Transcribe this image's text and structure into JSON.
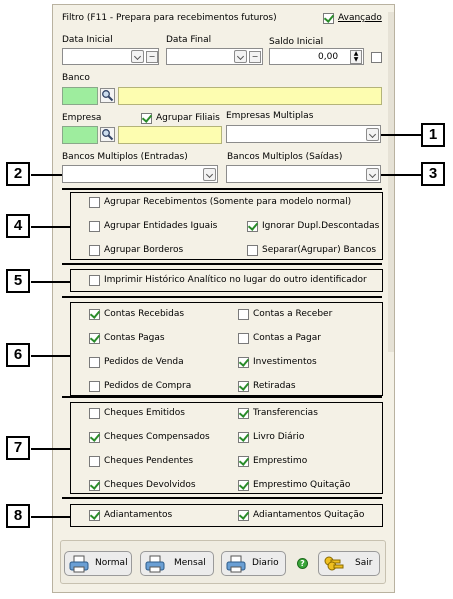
{
  "filter": {
    "title": "Filtro (F11 - Prepara para recebimentos futuros)",
    "advanced_label": "Avançado",
    "advanced_checked": true
  },
  "fields": {
    "data_inicial_label": "Data Inicial",
    "data_final_label": "Data Final",
    "saldo_inicial_label": "Saldo Inicial",
    "saldo_inicial_value": "0,00",
    "banco_label": "Banco",
    "empresa_label": "Empresa",
    "agrupar_filiais_label": "Agrupar Filiais",
    "agrupar_filiais_checked": true,
    "empresas_multiplas_label": "Empresas Multiplas",
    "bancos_multiplos_entradas_label": "Bancos Multiplos (Entradas)",
    "bancos_multiplos_saidas_label": "Bancos Multiplos (Saídas)"
  },
  "group4": {
    "agrupar_recebimentos": {
      "label": "Agrupar Recebimentos (Somente para modelo normal)",
      "checked": false
    },
    "agrupar_entidades": {
      "label": "Agrupar Entidades Iguais",
      "checked": false
    },
    "ignorar_dupl": {
      "label": "Ignorar Dupl.Descontadas",
      "checked": true
    },
    "agrupar_borderos": {
      "label": "Agrupar Borderos",
      "checked": false
    },
    "separar_bancos": {
      "label": "Separar(Agrupar) Bancos",
      "checked": false
    }
  },
  "group5": {
    "imprimir_historico": {
      "label": "Imprimir Histórico Analítico no lugar do outro identificador",
      "checked": false
    }
  },
  "group6": {
    "contas_recebidas": {
      "label": "Contas Recebidas",
      "checked": true
    },
    "contas_receber": {
      "label": "Contas a Receber",
      "checked": false
    },
    "contas_pagas": {
      "label": "Contas Pagas",
      "checked": true
    },
    "contas_pagar": {
      "label": "Contas a Pagar",
      "checked": false
    },
    "pedidos_venda": {
      "label": "Pedidos de Venda",
      "checked": false
    },
    "investimentos": {
      "label": "Investimentos",
      "checked": true
    },
    "pedidos_compra": {
      "label": "Pedidos de Compra",
      "checked": false
    },
    "retiradas": {
      "label": "Retiradas",
      "checked": true
    }
  },
  "group7": {
    "cheques_emitidos": {
      "label": "Cheques Emitidos",
      "checked": false
    },
    "transferencias": {
      "label": "Transferencias",
      "checked": true
    },
    "cheques_compensados": {
      "label": "Cheques Compensados",
      "checked": true
    },
    "livro_diario": {
      "label": "Livro Diário",
      "checked": true
    },
    "cheques_pendentes": {
      "label": "Cheques Pendentes",
      "checked": false
    },
    "emprestimo": {
      "label": "Emprestimo",
      "checked": true
    },
    "cheques_devolvidos": {
      "label": "Cheques Devolvidos",
      "checked": true
    },
    "emprestimo_quitacao": {
      "label": "Emprestimo Quitação",
      "checked": true
    }
  },
  "group8": {
    "adiantamentos": {
      "label": "Adiantamentos",
      "checked": true
    },
    "adiantamentos_quitacao": {
      "label": "Adiantamentos Quitação",
      "checked": true
    }
  },
  "buttons": {
    "normal": "Normal",
    "mensal": "Mensal",
    "diario": "Diario",
    "sair": "Sair"
  },
  "callouts": [
    "1",
    "2",
    "3",
    "4",
    "5",
    "6",
    "7",
    "8"
  ],
  "colors": {
    "panel": "#f4f1e6",
    "green_field": "#9eed9e",
    "yellow_field": "#fdfdb0",
    "check": "#2a8c2a"
  }
}
